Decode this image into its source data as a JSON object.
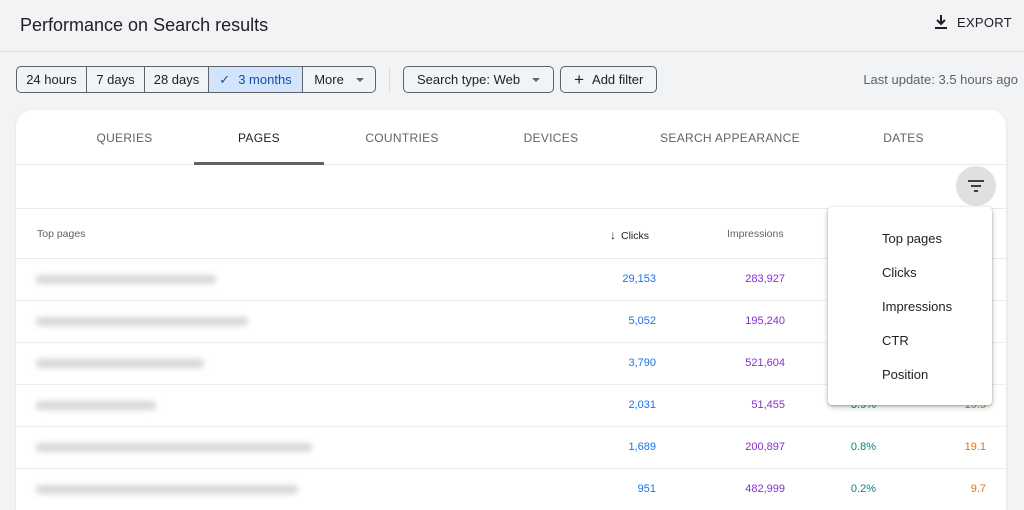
{
  "header": {
    "title": "Performance on Search results",
    "export_label": "EXPORT",
    "export_icon": "download-icon"
  },
  "date_range": {
    "options": [
      "24 hours",
      "7 days",
      "28 days",
      "3 months",
      "More"
    ],
    "selected": "3 months",
    "check_icon": "✓"
  },
  "filters": {
    "search_type": "Search type: Web",
    "add_filter": "Add filter",
    "add_icon": "+"
  },
  "last_update": "Last update: 3.5 hours ago",
  "tabs": [
    "QUERIES",
    "PAGES",
    "COUNTRIES",
    "DEVICES",
    "SEARCH APPEARANCE",
    "DATES"
  ],
  "active_tab": "PAGES",
  "table": {
    "headers": {
      "page": "Top pages",
      "clicks": "Clicks",
      "impressions": "Impressions",
      "sort_icon": "↓"
    },
    "rows": [
      {
        "clicks": "29,153",
        "impressions": "283,927",
        "ctr": "",
        "position": ""
      },
      {
        "clicks": "5,052",
        "impressions": "195,240",
        "ctr": "",
        "position": ""
      },
      {
        "clicks": "3,790",
        "impressions": "521,604",
        "ctr": "",
        "position": ""
      },
      {
        "clicks": "2,031",
        "impressions": "51,455",
        "ctr": "3.9%",
        "position": "19.5"
      },
      {
        "clicks": "1,689",
        "impressions": "200,897",
        "ctr": "0.8%",
        "position": "19.1"
      },
      {
        "clicks": "951",
        "impressions": "482,999",
        "ctr": "0.2%",
        "position": "9.7"
      }
    ]
  },
  "filter_menu": {
    "icon": "filter-list-icon",
    "items": [
      "Top pages",
      "Clicks",
      "Impressions",
      "CTR",
      "Position"
    ]
  },
  "colors": {
    "clicks": "#1a73e8",
    "impressions": "#8430ce",
    "ctr": "#00897b",
    "position": "#e8710a",
    "active_segment": "#d2e3fc"
  }
}
